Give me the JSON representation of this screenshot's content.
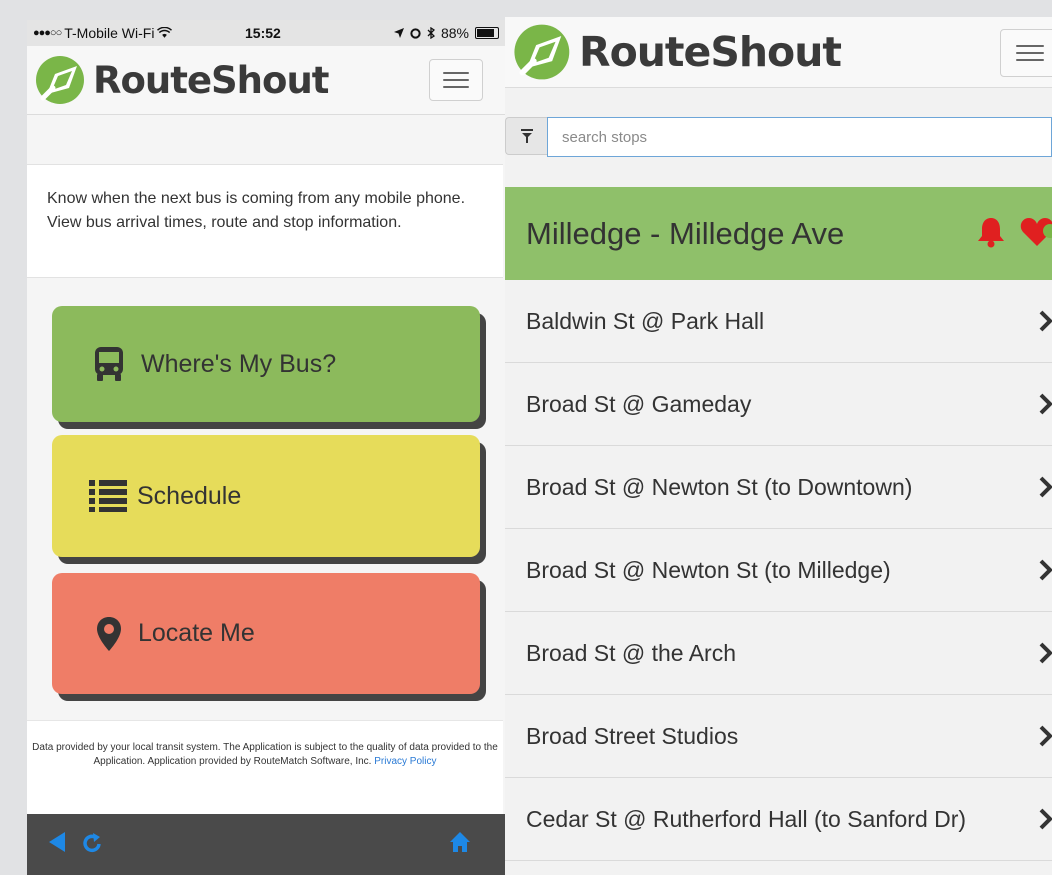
{
  "left": {
    "status": {
      "carrier": "T-Mobile Wi-Fi",
      "time": "15:52",
      "battery": "88%"
    },
    "brand": "RouteShout",
    "intro": "Know when the next bus is coming from any mobile phone. View bus arrival times, route and stop information.",
    "tiles": [
      {
        "label": "Where's My Bus?",
        "icon": "bus-icon",
        "color": "#8cba5c"
      },
      {
        "label": "Schedule",
        "icon": "list-icon",
        "color": "#e6dc5a"
      },
      {
        "label": "Locate Me",
        "icon": "map-marker-icon",
        "color": "#ef7d67"
      }
    ],
    "footer": {
      "text": "Data provided by your local transit system. The Application is subject to the quality of data provided to the Application. Application provided by RouteMatch Software, Inc.",
      "link": "Privacy Policy"
    }
  },
  "right": {
    "brand": "RouteShout",
    "search": {
      "placeholder": "search stops",
      "value": ""
    },
    "route_title": "Milledge - Milledge Ave",
    "stops": [
      "Baldwin St @ Park Hall",
      "Broad St @ Gameday",
      "Broad St @ Newton St (to Downtown)",
      "Broad St @ Newton St (to Milledge)",
      "Broad St @ the Arch",
      "Broad Street Studios",
      "Cedar St @ Rutherford Hall (to Sanford Dr)"
    ]
  },
  "colors": {
    "accent_blue": "#1e88e5",
    "route_header": "#8fc06a",
    "bell_red": "#e02020",
    "logo_green": "#7ab648"
  }
}
